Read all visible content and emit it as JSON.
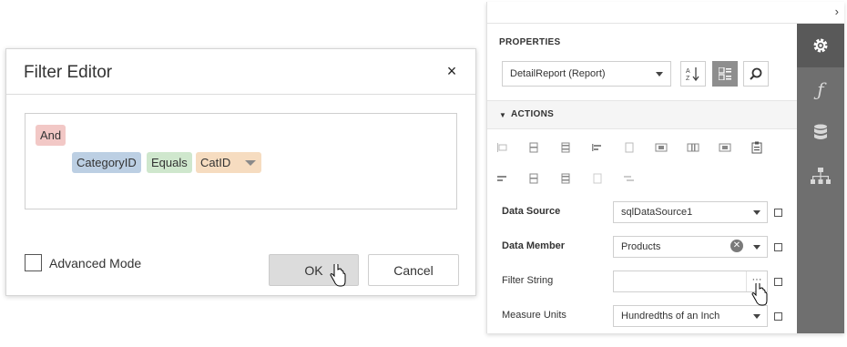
{
  "dialog": {
    "title": "Filter Editor",
    "close_icon": "×",
    "filter": {
      "group_operator": "And",
      "field": "CategoryID",
      "operator": "Equals",
      "value": "CatID"
    },
    "advanced_mode_label": "Advanced Mode",
    "advanced_mode_checked": false,
    "ok_label": "OK",
    "cancel_label": "Cancel"
  },
  "panel": {
    "collapse_icon": "›",
    "title": "PROPERTIES",
    "report_select": "DetailReport (Report)",
    "tools": {
      "sort_icon": "A↓Z",
      "categories_icon": "▦",
      "search_icon": "⌕"
    },
    "actions_label": "ACTIONS",
    "actions_arrow": "▼",
    "properties": [
      {
        "label": "Data Source",
        "value": "sqlDataSource1",
        "bold": true
      },
      {
        "label": "Data Member",
        "value": "Products",
        "bold": true
      },
      {
        "label": "Filter String",
        "value": "",
        "bold": false,
        "button": "···"
      },
      {
        "label": "Measure Units",
        "value": "Hundredths of an Inch",
        "bold": false
      }
    ],
    "sidebar_tabs": [
      {
        "name": "gear-icon",
        "glyph": "⚙"
      },
      {
        "name": "function-icon",
        "glyph": "f"
      },
      {
        "name": "database-icon",
        "glyph": "≣"
      },
      {
        "name": "report-explorer-icon",
        "glyph": "⊤"
      }
    ]
  },
  "colors": {
    "and_chip": "#f2c8c6",
    "field_chip": "#bccfe3",
    "operator_chip": "#cfe7cd",
    "value_chip": "#f6dcc0",
    "sidebar": "#6f6f6f",
    "sidebar_active": "#595959"
  }
}
